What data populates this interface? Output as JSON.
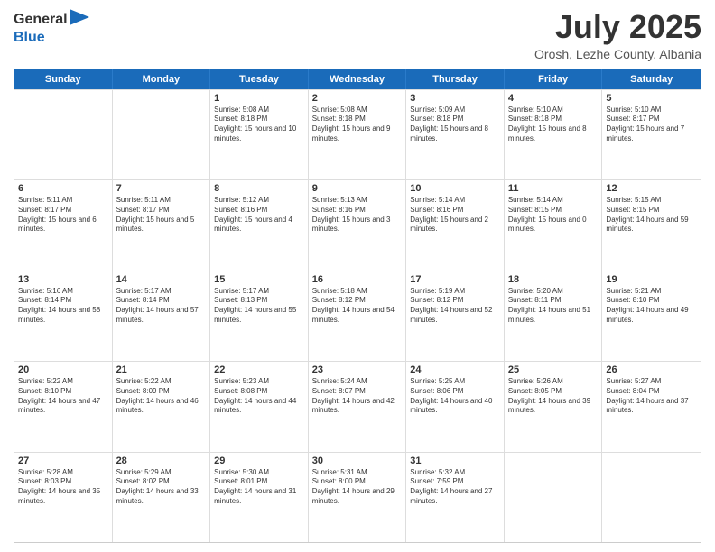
{
  "header": {
    "logo_general": "General",
    "logo_blue": "Blue",
    "month_title": "July 2025",
    "location": "Orosh, Lezhe County, Albania"
  },
  "days_of_week": [
    "Sunday",
    "Monday",
    "Tuesday",
    "Wednesday",
    "Thursday",
    "Friday",
    "Saturday"
  ],
  "weeks": [
    [
      {
        "day": "",
        "info": ""
      },
      {
        "day": "",
        "info": ""
      },
      {
        "day": "1",
        "info": "Sunrise: 5:08 AM\nSunset: 8:18 PM\nDaylight: 15 hours and 10 minutes."
      },
      {
        "day": "2",
        "info": "Sunrise: 5:08 AM\nSunset: 8:18 PM\nDaylight: 15 hours and 9 minutes."
      },
      {
        "day": "3",
        "info": "Sunrise: 5:09 AM\nSunset: 8:18 PM\nDaylight: 15 hours and 8 minutes."
      },
      {
        "day": "4",
        "info": "Sunrise: 5:10 AM\nSunset: 8:18 PM\nDaylight: 15 hours and 8 minutes."
      },
      {
        "day": "5",
        "info": "Sunrise: 5:10 AM\nSunset: 8:17 PM\nDaylight: 15 hours and 7 minutes."
      }
    ],
    [
      {
        "day": "6",
        "info": "Sunrise: 5:11 AM\nSunset: 8:17 PM\nDaylight: 15 hours and 6 minutes."
      },
      {
        "day": "7",
        "info": "Sunrise: 5:11 AM\nSunset: 8:17 PM\nDaylight: 15 hours and 5 minutes."
      },
      {
        "day": "8",
        "info": "Sunrise: 5:12 AM\nSunset: 8:16 PM\nDaylight: 15 hours and 4 minutes."
      },
      {
        "day": "9",
        "info": "Sunrise: 5:13 AM\nSunset: 8:16 PM\nDaylight: 15 hours and 3 minutes."
      },
      {
        "day": "10",
        "info": "Sunrise: 5:14 AM\nSunset: 8:16 PM\nDaylight: 15 hours and 2 minutes."
      },
      {
        "day": "11",
        "info": "Sunrise: 5:14 AM\nSunset: 8:15 PM\nDaylight: 15 hours and 0 minutes."
      },
      {
        "day": "12",
        "info": "Sunrise: 5:15 AM\nSunset: 8:15 PM\nDaylight: 14 hours and 59 minutes."
      }
    ],
    [
      {
        "day": "13",
        "info": "Sunrise: 5:16 AM\nSunset: 8:14 PM\nDaylight: 14 hours and 58 minutes."
      },
      {
        "day": "14",
        "info": "Sunrise: 5:17 AM\nSunset: 8:14 PM\nDaylight: 14 hours and 57 minutes."
      },
      {
        "day": "15",
        "info": "Sunrise: 5:17 AM\nSunset: 8:13 PM\nDaylight: 14 hours and 55 minutes."
      },
      {
        "day": "16",
        "info": "Sunrise: 5:18 AM\nSunset: 8:12 PM\nDaylight: 14 hours and 54 minutes."
      },
      {
        "day": "17",
        "info": "Sunrise: 5:19 AM\nSunset: 8:12 PM\nDaylight: 14 hours and 52 minutes."
      },
      {
        "day": "18",
        "info": "Sunrise: 5:20 AM\nSunset: 8:11 PM\nDaylight: 14 hours and 51 minutes."
      },
      {
        "day": "19",
        "info": "Sunrise: 5:21 AM\nSunset: 8:10 PM\nDaylight: 14 hours and 49 minutes."
      }
    ],
    [
      {
        "day": "20",
        "info": "Sunrise: 5:22 AM\nSunset: 8:10 PM\nDaylight: 14 hours and 47 minutes."
      },
      {
        "day": "21",
        "info": "Sunrise: 5:22 AM\nSunset: 8:09 PM\nDaylight: 14 hours and 46 minutes."
      },
      {
        "day": "22",
        "info": "Sunrise: 5:23 AM\nSunset: 8:08 PM\nDaylight: 14 hours and 44 minutes."
      },
      {
        "day": "23",
        "info": "Sunrise: 5:24 AM\nSunset: 8:07 PM\nDaylight: 14 hours and 42 minutes."
      },
      {
        "day": "24",
        "info": "Sunrise: 5:25 AM\nSunset: 8:06 PM\nDaylight: 14 hours and 40 minutes."
      },
      {
        "day": "25",
        "info": "Sunrise: 5:26 AM\nSunset: 8:05 PM\nDaylight: 14 hours and 39 minutes."
      },
      {
        "day": "26",
        "info": "Sunrise: 5:27 AM\nSunset: 8:04 PM\nDaylight: 14 hours and 37 minutes."
      }
    ],
    [
      {
        "day": "27",
        "info": "Sunrise: 5:28 AM\nSunset: 8:03 PM\nDaylight: 14 hours and 35 minutes."
      },
      {
        "day": "28",
        "info": "Sunrise: 5:29 AM\nSunset: 8:02 PM\nDaylight: 14 hours and 33 minutes."
      },
      {
        "day": "29",
        "info": "Sunrise: 5:30 AM\nSunset: 8:01 PM\nDaylight: 14 hours and 31 minutes."
      },
      {
        "day": "30",
        "info": "Sunrise: 5:31 AM\nSunset: 8:00 PM\nDaylight: 14 hours and 29 minutes."
      },
      {
        "day": "31",
        "info": "Sunrise: 5:32 AM\nSunset: 7:59 PM\nDaylight: 14 hours and 27 minutes."
      },
      {
        "day": "",
        "info": ""
      },
      {
        "day": "",
        "info": ""
      }
    ]
  ]
}
